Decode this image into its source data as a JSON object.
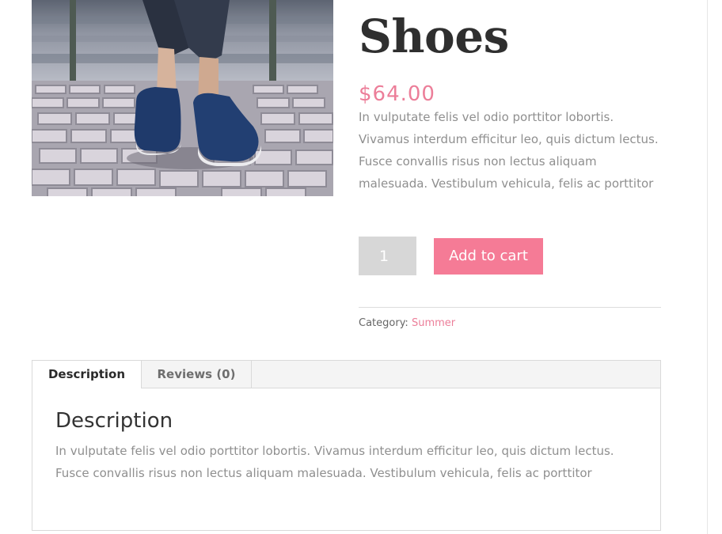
{
  "product": {
    "title": "Shoes",
    "price": "$64.00",
    "short_description": "In vulputate felis vel odio porttitor lobortis. Vivamus interdum efficitur leo, quis dictum lectus. Fusce convallis risus non lectus aliquam malesuada. Vestibulum vehicula, felis ac porttitor",
    "image_alt": "Person wearing blue slip-on shoes on tiled pavement"
  },
  "cart": {
    "quantity": "1",
    "add_to_cart_label": "Add to cart"
  },
  "meta": {
    "category_label": "Category:",
    "category_value": "Summer"
  },
  "tabs": [
    {
      "label": "Description",
      "active": true
    },
    {
      "label": "Reviews (0)",
      "active": false
    }
  ],
  "panel": {
    "title": "Description",
    "text": "In vulputate felis vel odio porttitor lobortis. Vivamus interdum efficitur leo, quis dictum lectus. Fusce convallis risus non lectus aliquam malesuada. Vestibulum vehicula, felis ac porttitor"
  },
  "colors": {
    "accent": "#f57b96",
    "price": "#ec7e99",
    "body_text": "#8f8f8f",
    "title": "#2f2f2f",
    "qty_bg": "#d7d7d7"
  }
}
